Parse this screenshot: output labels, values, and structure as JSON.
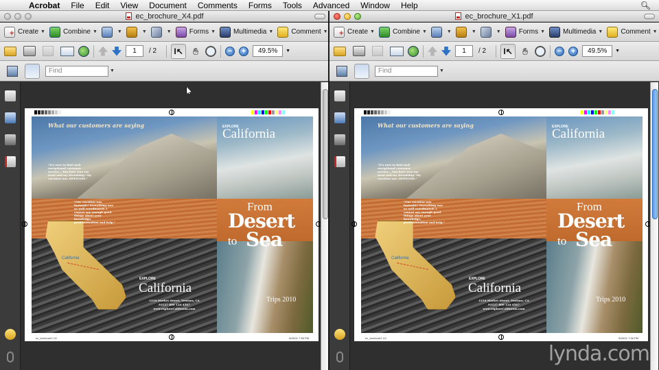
{
  "menubar": {
    "app": "Acrobat",
    "items": [
      "File",
      "Edit",
      "View",
      "Document",
      "Comments",
      "Forms",
      "Tools",
      "Advanced",
      "Window",
      "Help"
    ]
  },
  "toolbar": {
    "create": "Create",
    "combine": "Combine",
    "forms": "Forms",
    "multimedia": "Multimedia",
    "comment": "Comment",
    "page_current": "1",
    "page_total": "/ 2",
    "zoom": "49.5%",
    "find_placeholder": "Find"
  },
  "windows": [
    {
      "title": "ec_brochure_X4.pdf",
      "active": false,
      "document": {
        "quote_head": "What our customers are saying",
        "quote1": "\"It's rare to find such exceptional customer service… You have won my trust and my friendship! My vacation was AWESOME.\"",
        "quote2": "\"Our vacation was fantastic! Everything was so well coordinated. I cannot say enough good things about your knowledge, professionalism and help.\"",
        "map_label": "California",
        "explore_small": "EXPLORE",
        "california": "California",
        "address": "1234 Market Street, Ventura, CA 93127 800 124 4567 www.exploreCalifornia.com",
        "from": "From",
        "desert": "Desert",
        "to": "to",
        "sea": "Sea",
        "trips": "Trips 2010",
        "footer_left": "ec_brochure2 1G",
        "footer_right": "5/28/11 7:36 PM"
      }
    },
    {
      "title": "ec_brochure_X1.pdf",
      "active": true,
      "document": {
        "quote_head": "What our customers are saying",
        "quote1": "\"It's rare to find such exceptional customer service… You have won my trust and my friendship! My vacation was AWESOME.\"",
        "quote2": "\"Our vacation was fantastic! Everything was so well coordinated. I cannot say enough good things about your knowledge, professionalism and help.\"",
        "map_label": "California",
        "explore_small": "EXPLORE",
        "california": "California",
        "address": "1234 Market Street, Ventura, CA 93127 800 124 4567 www.exploreCalifornia.com",
        "from": "From",
        "desert": "Desert",
        "to": "to",
        "sea": "Sea",
        "trips": "Trips 2010",
        "footer_left": "ec_brochure2 1G",
        "footer_right": "5/28/11 7:36 PM"
      }
    }
  ],
  "watermark": "lynda.com",
  "colors": {
    "orange_band": "#c26c34",
    "scrollbar_active": "#5a9be8"
  },
  "icons": [
    "apple-icon",
    "spotlight-icon",
    "create-icon",
    "combine-icon",
    "share-icon",
    "lock-icon",
    "pen-icon",
    "forms-icon",
    "multimedia-icon",
    "comment-icon",
    "open-icon",
    "print-icon",
    "save-icon",
    "email-icon",
    "globe-icon",
    "prev-page-icon",
    "next-page-icon",
    "select-icon",
    "hand-icon",
    "zoom-tool-icon",
    "zoom-out-icon",
    "zoom-in-icon",
    "scan-icon",
    "fit-page-icon",
    "pages-icon",
    "bookmarks-icon",
    "signatures-icon",
    "attachments-icon",
    "comments-icon",
    "paperclip-icon"
  ]
}
